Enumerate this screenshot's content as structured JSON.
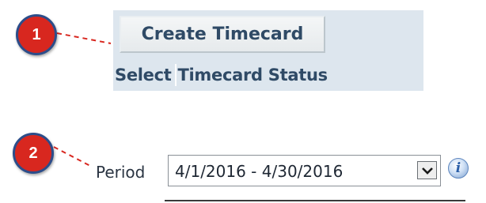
{
  "callouts": {
    "one": "1",
    "two": "2"
  },
  "timecard": {
    "create_button_label": "Create Timecard",
    "columns": [
      "Select",
      "Timecard Status"
    ]
  },
  "period": {
    "label": "Period",
    "value": "4/1/2016 - 4/30/2016"
  },
  "icons": {
    "dropdown": "chevron-down-icon",
    "info": "info-icon",
    "info_glyph": "i"
  },
  "colors": {
    "badge_fill": "#d8271f",
    "badge_border": "#2c4d8a",
    "panel_bg": "#dde6ee",
    "header_text": "#2f4a66"
  }
}
